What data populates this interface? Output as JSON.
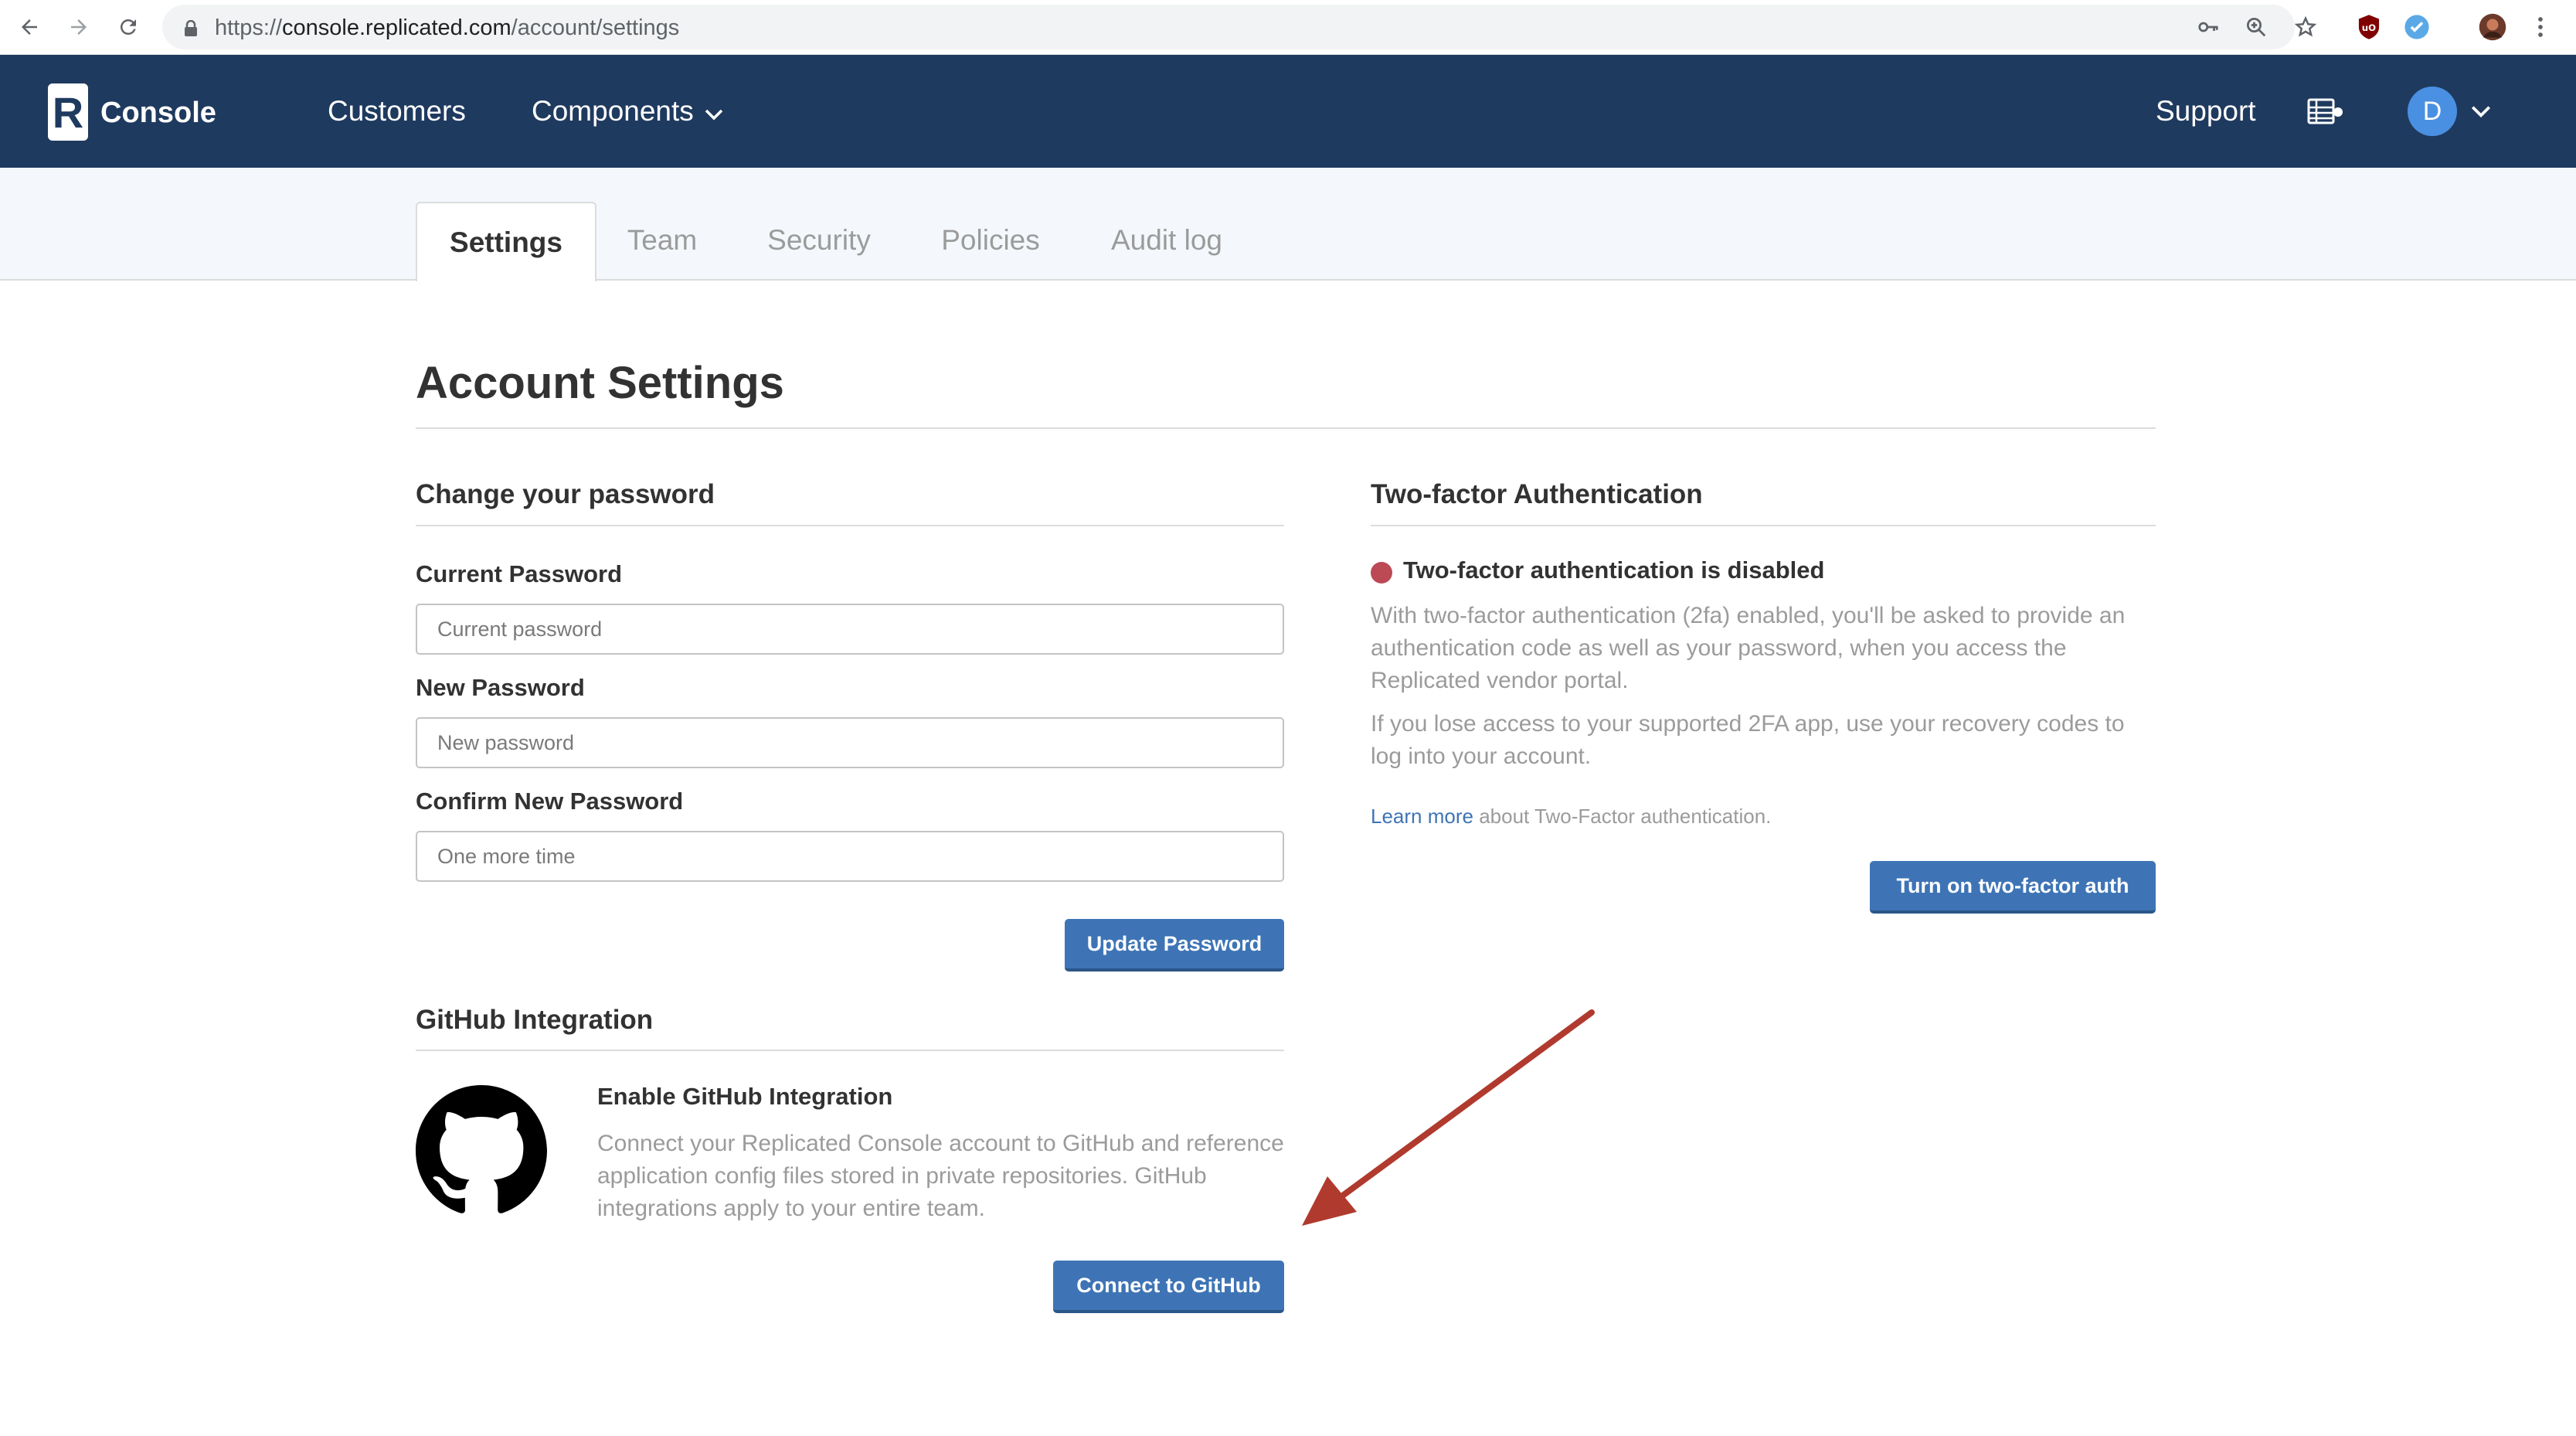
{
  "browser": {
    "url_scheme": "https://",
    "url_host": "console.replicated.com",
    "url_path": "/account/settings"
  },
  "navbar": {
    "logo_letter": "R",
    "logo_text": "Console",
    "links": [
      {
        "label": "Customers"
      },
      {
        "label": "Components"
      }
    ],
    "support_label": "Support",
    "avatar_initial": "D"
  },
  "tabs": [
    {
      "label": "Settings",
      "active": true
    },
    {
      "label": "Team",
      "active": false
    },
    {
      "label": "Security",
      "active": false
    },
    {
      "label": "Policies",
      "active": false
    },
    {
      "label": "Audit log",
      "active": false
    }
  ],
  "page": {
    "title": "Account Settings"
  },
  "password": {
    "section_title": "Change your password",
    "current_label": "Current Password",
    "current_placeholder": "Current password",
    "new_label": "New Password",
    "new_placeholder": "New password",
    "confirm_label": "Confirm New Password",
    "confirm_placeholder": "One more time",
    "submit_label": "Update Password"
  },
  "twofa": {
    "section_title": "Two-factor Authentication",
    "status_text": "Two-factor authentication is disabled",
    "status_color": "#bb4a55",
    "desc1": "With two-factor authentication (2fa) enabled, you'll be asked to provide an authentication code as well as your password, when you access the Replicated vendor portal.",
    "desc2": "If you lose access to your supported 2FA app, use your recovery codes to log into your account.",
    "learn_more_link": "Learn more",
    "learn_more_rest": " about Two-Factor authentication.",
    "button_label": "Turn on two-factor auth"
  },
  "github": {
    "section_title": "GitHub Integration",
    "heading": "Enable GitHub Integration",
    "description": "Connect your Replicated Console account to GitHub and reference application config files stored in private repositories. GitHub integrations apply to your entire team.",
    "button_label": "Connect to GitHub"
  },
  "colors": {
    "navbar_bg": "#1f3a5f",
    "primary_button": "#3e74b5",
    "annotation_arrow": "#b03a2e"
  }
}
